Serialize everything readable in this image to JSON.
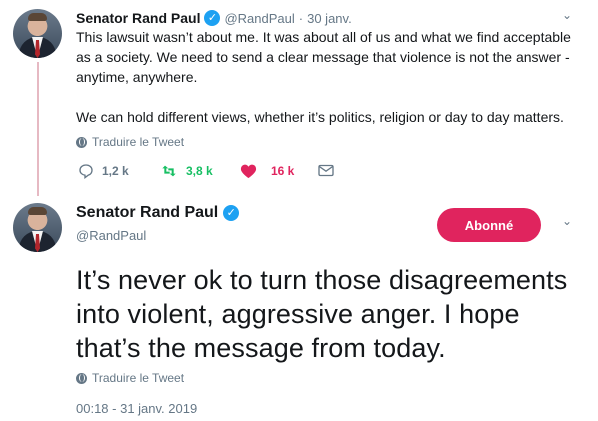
{
  "tweet1": {
    "name": "Senator Rand Paul",
    "handle": "@RandPaul",
    "separator": "·",
    "date": "30 janv.",
    "text": "This lawsuit wasn’t about me. It was about all of us and what we find acceptable\nas a society. We need to send a clear message that violence is not the answer -\nanytime, anywhere.\n\nWe can hold different views, whether it’s politics, religion or day to day matters.",
    "translate": "Traduire le Tweet",
    "replies": "1,2 k",
    "retweets": "3,8 k",
    "likes": "16 k",
    "colors": {
      "retweet": "#17bf63",
      "like": "#e0245e"
    }
  },
  "tweet2": {
    "name": "Senator Rand Paul",
    "handle": "@RandPaul",
    "follow_label": "Abonné",
    "text": "It’s never ok to turn those disagreements\ninto violent, aggressive anger. I hope\nthat’s the message from today.",
    "translate": "Traduire le Tweet",
    "timestamp": "00:18 - 31 janv. 2019"
  },
  "icons": {
    "verified": "verified-badge-icon",
    "chevron": "chevron-down-icon",
    "reply": "reply-icon",
    "retweet": "retweet-icon",
    "like": "heart-icon",
    "dm": "envelope-icon",
    "globe": "globe-icon"
  },
  "colors": {
    "accent": "#1da1f2",
    "follow": "#e0245e",
    "thread": "#e6b9c3",
    "muted": "#657786"
  }
}
